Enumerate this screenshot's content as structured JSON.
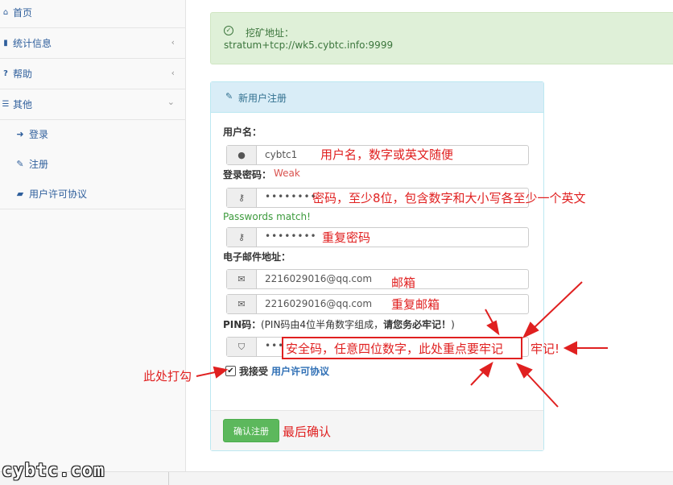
{
  "sidebar": {
    "items": [
      {
        "label": "首页",
        "icon": "home-icon"
      },
      {
        "label": "统计信息",
        "icon": "bar-chart-icon"
      },
      {
        "label": "帮助",
        "icon": "question-icon"
      },
      {
        "label": "其他",
        "icon": "list-icon"
      }
    ],
    "sub_items": [
      {
        "label": "登录",
        "icon": "sign-in-icon"
      },
      {
        "label": "注册",
        "icon": "pencil-icon"
      },
      {
        "label": "用户许可协议",
        "icon": "book-icon"
      }
    ]
  },
  "alert": {
    "title": "挖矿地址：",
    "address": "stratum+tcp://wk5.cybtc.info:9999"
  },
  "panel": {
    "title": "新用户注册"
  },
  "form": {
    "username_label": "用户名：",
    "username_value": "cybtc1",
    "password_label": "登录密码：",
    "password_strength": "Weak",
    "password_dots": "••••••••",
    "password_match": "Passwords match!",
    "password2_dots": "••••••••",
    "email_label": "电子邮件地址：",
    "email_value": "2216029016@qq.com",
    "email2_value": "2216029016@qq.com",
    "pin_label": "PIN码：",
    "pin_note_pre": "(PIN码由4位半角数字组成，",
    "pin_note_bold": "请您务必牢记！",
    "pin_note_post": ")",
    "pin_dots": "••••",
    "agree_text": "我接受",
    "agree_link": "用户许可协议",
    "submit_label": "确认注册"
  },
  "annotations": {
    "username": "用户名，数字或英文随便",
    "password": "密码，至少8位，包含数字和大小写各至少一个英文",
    "password2": "重复密码",
    "email": "邮箱",
    "email2": "重复邮箱",
    "pin": "安全码，任意四位数字，此处重点要牢记",
    "remember": "牢记!",
    "checkbox": "此处打勾",
    "confirm": "最后确认"
  },
  "watermark": "cybtc.com",
  "colors": {
    "annotation_red": "#e02020",
    "success_green": "#5cb85c",
    "link_blue": "#2f6fb5"
  }
}
